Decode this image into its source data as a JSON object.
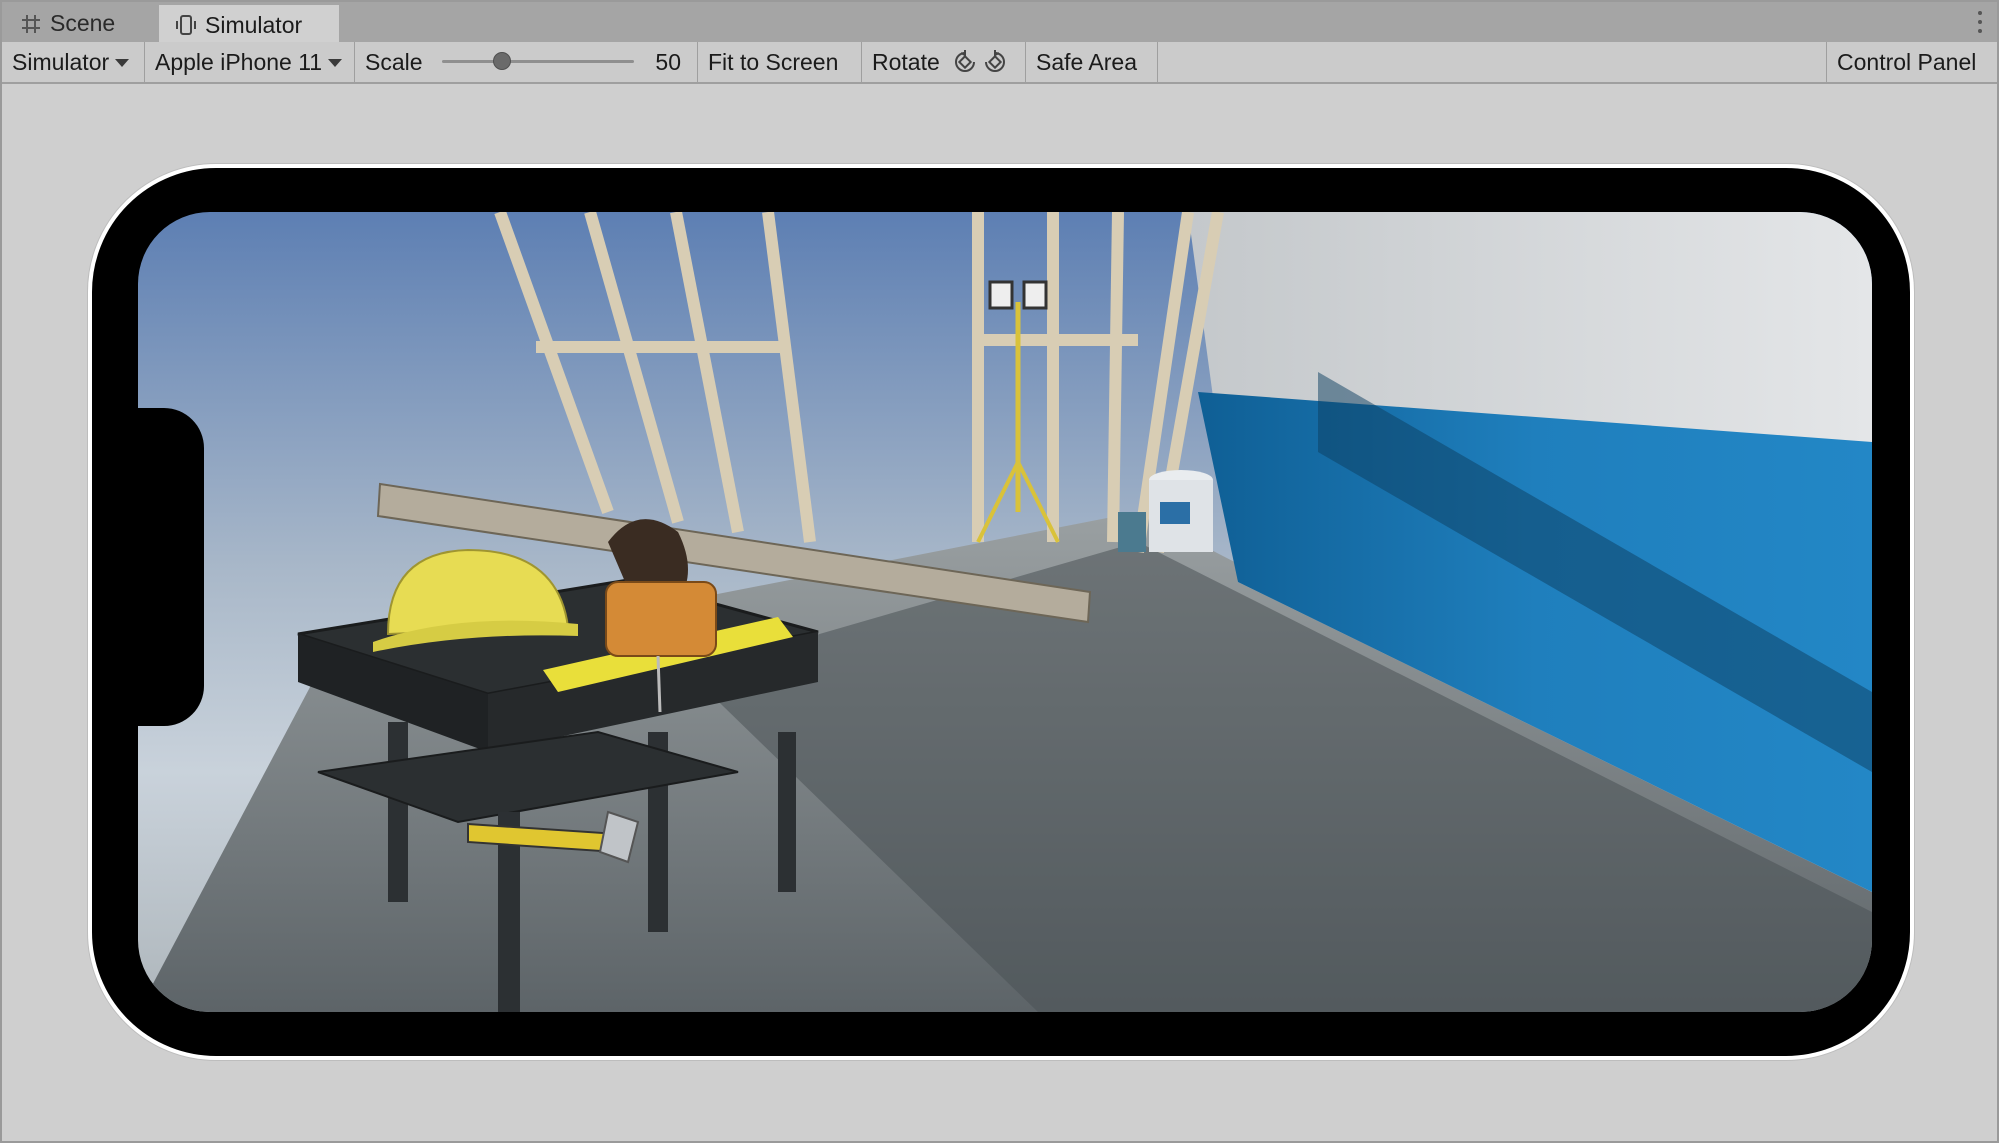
{
  "tabs": [
    {
      "label": "Scene",
      "icon": "grid-icon",
      "active": false
    },
    {
      "label": "Simulator",
      "icon": "device-icon",
      "active": true
    }
  ],
  "toolbar": {
    "mode_label": "Simulator",
    "device_label": "Apple iPhone 11",
    "scale_label": "Scale",
    "scale_value": "50",
    "scale_fraction": 0.5,
    "fit_label": "Fit to Screen",
    "rotate_label": "Rotate",
    "safe_area_label": "Safe Area",
    "control_panel_label": "Control Panel"
  },
  "colors": {
    "sky_top": "#5d7fb3",
    "sky_horizon": "#c9d2db",
    "floor": "#7b8387",
    "wall_blue": "#1d78b3",
    "hardhat_yellow": "#e7dc53"
  }
}
